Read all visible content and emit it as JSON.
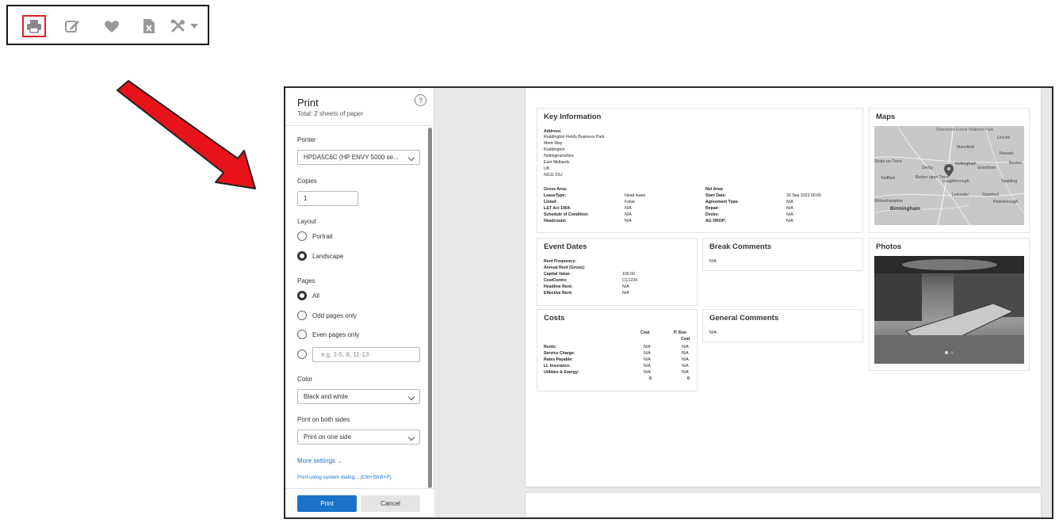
{
  "toolbar": {
    "icons": [
      "printer-icon",
      "edit-icon",
      "heart-icon",
      "excel-file-icon",
      "tools-icon",
      "caret-down-icon"
    ],
    "selected": "printer-icon",
    "selected_color": "#e02020"
  },
  "arrow": {
    "color": "#e8121a"
  },
  "print_panel": {
    "title": "Print",
    "subtitle": "Total: 2 sheets of paper",
    "help": "?",
    "printer_label": "Printer",
    "printer_value": "HPDA5C6C (HP ENVY 5000 se...",
    "copies_label": "Copies",
    "copies_value": "1",
    "layout_label": "Layout",
    "layout_options": [
      "Portrait",
      "Landscape"
    ],
    "layout_selected": "Landscape",
    "pages_label": "Pages",
    "pages_options": [
      "All",
      "Odd pages only",
      "Even pages only"
    ],
    "pages_selected": "All",
    "pages_custom_placeholder": "e.g. 1-5, 8, 11-13",
    "color_label": "Color",
    "color_value": "Black and white",
    "duplex_label": "Print on both sides",
    "duplex_value": "Print on one side",
    "more_settings": "More settings",
    "system_dialog": "Print using system dialog... (Ctrl+Shift+P)",
    "print_button": "Print",
    "cancel_button": "Cancel",
    "accent": "#1b72c9"
  },
  "preview": {
    "key_info": {
      "title": "Key Information",
      "address_label": "Address:",
      "address_lines": [
        "Ruddington Fields Business Park",
        "Mere Way",
        "Ruddington",
        "Nottinghamshire",
        "East Midlands",
        "UK",
        "NG11 6SJ"
      ],
      "left_labels": [
        "Gross Area:",
        "LeaseType:",
        "Listed:",
        "L&T Act 1954:",
        "Schedule of Condition:",
        "Headcount:"
      ],
      "left_values": [
        "",
        "Head lease",
        "False",
        "N/A",
        "N/A",
        "N/A"
      ],
      "right_labels": [
        "Net Area:",
        "Start Date:",
        "Agreement Type:",
        "Repair:",
        "Desks:",
        "AG DROP:"
      ],
      "right_values": [
        "",
        "20 Sep 2023 00:00",
        "N/A",
        "N/A",
        "N/A",
        "N/A"
      ]
    },
    "maps": {
      "title": "Maps",
      "places": [
        "Sherwood Forest National Park",
        "Lincoln",
        "Mansfield",
        "Newark",
        "Stoke-on-Trent",
        "Derby",
        "Nottingham",
        "Grantham",
        "Boston",
        "Stafford",
        "Burton upon Trent",
        "Loughborough",
        "Spalding",
        "Wolverhampton",
        "Leicester",
        "Stamford",
        "Peterborough",
        "Birmingham"
      ]
    },
    "event_dates": {
      "title": "Event Dates",
      "labels": [
        "Rent Frequency:",
        "Annual Rent (Gross):",
        "Capital Value:",
        "CostCentre:",
        "Headline Rent:",
        "Effective Rent:"
      ],
      "values": [
        "",
        "",
        "100.00",
        "CC1234",
        "N/A",
        "N/A"
      ]
    },
    "break_comments": {
      "title": "Break Comments",
      "text": "N/A"
    },
    "photos": {
      "title": "Photos"
    },
    "costs": {
      "title": "Costs",
      "col_cost": "Cost",
      "col_psize_1": "P. Size",
      "col_psize_2": "Cost",
      "rows": [
        {
          "label": "Rents:",
          "cost": "N/A",
          "psize": "N/A"
        },
        {
          "label": "Service Charge:",
          "cost": "N/A",
          "psize": "N/A"
        },
        {
          "label": "Rates Payable:",
          "cost": "N/A",
          "psize": "N/A"
        },
        {
          "label": "LL Insurance:",
          "cost": "N/A",
          "psize": "N/A"
        },
        {
          "label": "Utilities & Energy:",
          "cost": "N/A",
          "psize": "N/A"
        }
      ],
      "total_cost": "0",
      "total_psize": "0"
    },
    "general_comments": {
      "title": "General Comments",
      "text": "N/A"
    }
  }
}
